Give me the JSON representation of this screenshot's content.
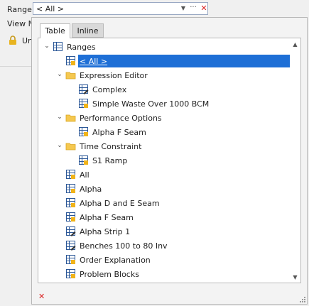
{
  "form": {
    "range_label": "Range",
    "range_value": "< All >",
    "viewname_label": "View Na",
    "lock_text": "Un"
  },
  "popup": {
    "tabs": [
      {
        "label": "Table",
        "active": true
      },
      {
        "label": "Inline",
        "active": false
      }
    ],
    "tree": [
      {
        "label": "Ranges",
        "icon": "table-icon",
        "depth": 0,
        "expander": "expanded"
      },
      {
        "label": "< All >",
        "icon": "range-icon",
        "depth": 1,
        "selected": true
      },
      {
        "label": "Expression Editor",
        "icon": "folder-icon",
        "depth": 1,
        "expander": "expanded"
      },
      {
        "label": "Complex",
        "icon": "range-edit-icon",
        "depth": 2
      },
      {
        "label": "Simple Waste Over 1000 BCM",
        "icon": "range-icon",
        "depth": 2
      },
      {
        "label": "Performance Options",
        "icon": "folder-icon",
        "depth": 1,
        "expander": "expanded"
      },
      {
        "label": "Alpha F Seam",
        "icon": "range-icon",
        "depth": 2
      },
      {
        "label": "Time Constraint",
        "icon": "folder-icon",
        "depth": 1,
        "expander": "expanded"
      },
      {
        "label": "S1 Ramp",
        "icon": "range-icon",
        "depth": 2
      },
      {
        "label": "All",
        "icon": "range-icon",
        "depth": 1
      },
      {
        "label": "Alpha",
        "icon": "range-icon",
        "depth": 1
      },
      {
        "label": "Alpha D and E Seam",
        "icon": "range-icon",
        "depth": 1
      },
      {
        "label": "Alpha F Seam",
        "icon": "range-icon",
        "depth": 1
      },
      {
        "label": "Alpha Strip 1",
        "icon": "range-edit-icon",
        "depth": 1
      },
      {
        "label": "Benches 100 to 80 Inv",
        "icon": "range-edit-icon",
        "depth": 1
      },
      {
        "label": "Order Explanation",
        "icon": "range-icon",
        "depth": 1
      },
      {
        "label": "Problem Blocks",
        "icon": "range-icon",
        "depth": 1
      }
    ]
  },
  "colors": {
    "selection": "#1e6fd6",
    "clear": "#d92020",
    "folder": "#f5c850",
    "grid": "#2b5797"
  }
}
